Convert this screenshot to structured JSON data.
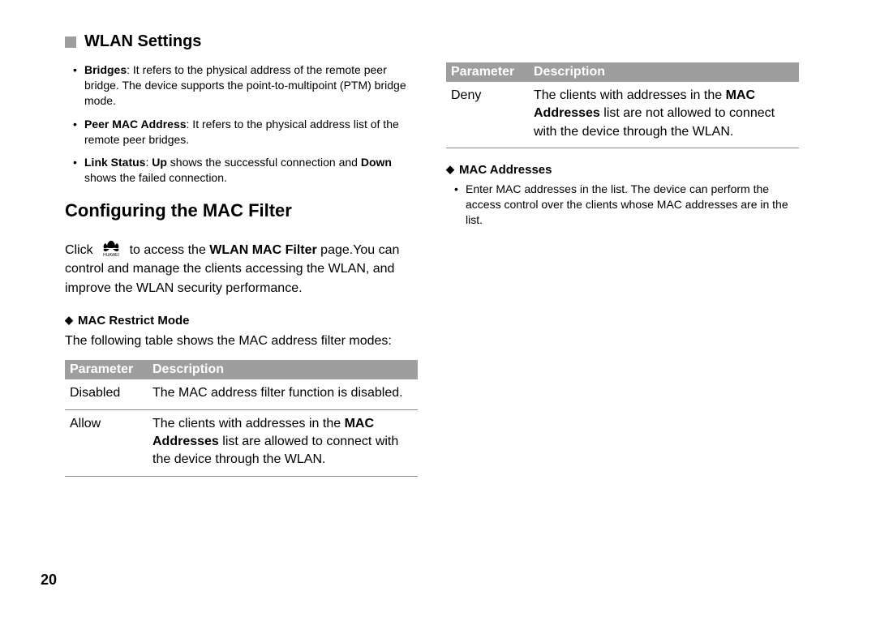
{
  "pageNumber": "20",
  "header": {
    "title": "WLAN Settings"
  },
  "leftColumn": {
    "bullets": [
      {
        "boldLead": "Bridges",
        "rest": ": It refers to the physical address of the remote peer bridge. The device supports the point-to-multipoint (PTM) bridge mode."
      },
      {
        "boldLead": "Peer MAC Address",
        "rest": ": It refers to the physical address list of the remote peer bridges."
      },
      {
        "pre": "",
        "boldLead": "Link Status",
        "mid": ": ",
        "bold2": "Up",
        "mid2": " shows the successful connection and ",
        "bold3": "Down",
        "rest": " shows the failed connection."
      }
    ],
    "sectionTitle": "Configuring the MAC Filter",
    "intro": {
      "pre": "Click ",
      "post1": " to access the ",
      "bold1": "WLAN MAC Filter",
      "post2": " page.You can control and manage the clients accessing the WLAN, and improve the WLAN security performance."
    },
    "sub1": {
      "title": "MAC Restrict Mode",
      "desc": "The following table shows the MAC address filter modes:"
    },
    "table": {
      "headers": [
        "Parameter",
        "Description"
      ],
      "rows": [
        {
          "param": "Disabled",
          "desc": "The MAC address filter function is disabled."
        },
        {
          "param": "Allow",
          "descPre": "The clients with addresses in the ",
          "descBold": "MAC Addresses",
          "descPost": " list are allowed to connect with the device through the WLAN."
        }
      ]
    }
  },
  "rightColumn": {
    "table": {
      "headers": [
        "Parameter",
        "Description"
      ],
      "rows": [
        {
          "param": "Deny",
          "descPre": "The clients with addresses in the ",
          "descBold": "MAC Addresses",
          "descPost": " list are not allowed to connect with the device through the WLAN."
        }
      ]
    },
    "sub1": {
      "title": "MAC Addresses"
    },
    "bullets": [
      "Enter MAC addresses in the list. The device can perform the access control over the clients whose MAC addresses are in the list."
    ]
  }
}
